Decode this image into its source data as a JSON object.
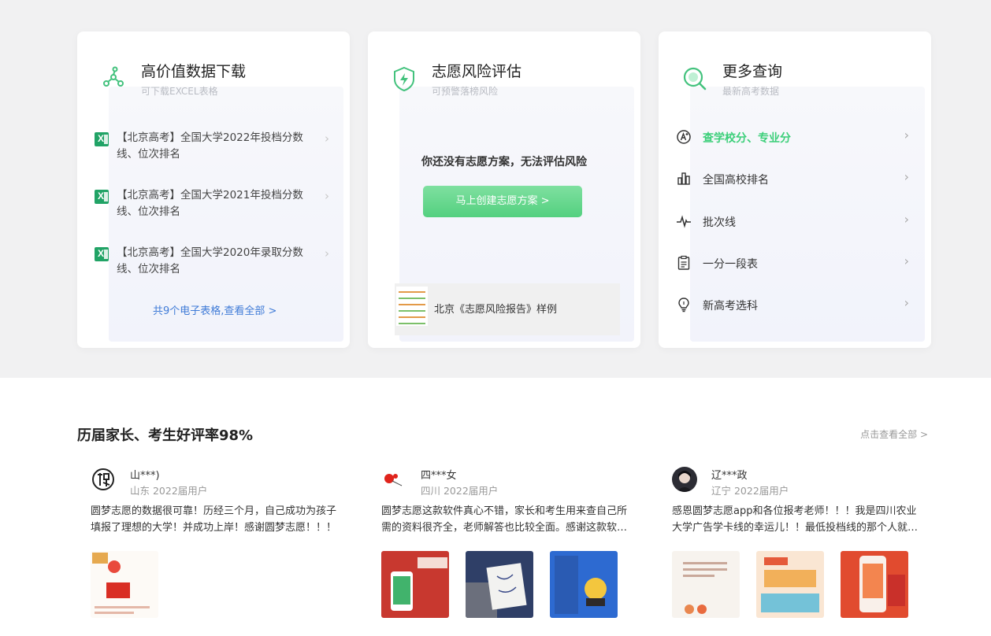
{
  "cards": {
    "download": {
      "title": "高价值数据下载",
      "subtitle": "可下载EXCEL表格",
      "items": [
        {
          "label": "【北京高考】全国大学2022年投档分数线、位次排名"
        },
        {
          "label": "【北京高考】全国大学2021年投档分数线、位次排名"
        },
        {
          "label": "【北京高考】全国大学2020年录取分数线、位次排名"
        }
      ],
      "see_all": "共9个电子表格,查看全部 >",
      "icon": "network-icon",
      "accent": "#43c27d"
    },
    "risk": {
      "title": "志愿风险评估",
      "subtitle": "可预警落榜风险",
      "message": "你还没有志愿方案，无法评估风险",
      "button": "马上创建志愿方案 >",
      "report": "北京《志愿风险报告》样例",
      "icon": "shield-bolt-icon",
      "button_color": "#53d07f"
    },
    "more": {
      "title": "更多查询",
      "subtitle": "最新高考数据",
      "icon": "search-icon",
      "items": [
        {
          "label": "查学校分、专业分",
          "icon": "score-icon",
          "active": true
        },
        {
          "label": "全国高校排名",
          "icon": "bar-chart-icon"
        },
        {
          "label": "批次线",
          "icon": "pulse-icon"
        },
        {
          "label": "一分一段表",
          "icon": "clipboard-icon"
        },
        {
          "label": "新高考选科",
          "icon": "bulb-icon"
        }
      ],
      "active_color": "#3bcf79"
    }
  },
  "reviews": {
    "title": "历届家长、考生好评率98%",
    "more": "点击查看全部 >",
    "items": [
      {
        "name": "山***)",
        "meta": "山东 2022届用户",
        "text": "圆梦志愿的数据很可靠！历经三个月，自己成功为孩子填报了理想的大学！并成功上岸！感谢圆梦志愿！！！",
        "photos": 1
      },
      {
        "name": "四***女",
        "meta": "四川 2022届用户",
        "text": "圆梦志愿这款软件真心不错，家长和考生用来查自己所需的资料很齐全，老师解答也比较全面。感谢这款软…",
        "photos": 3
      },
      {
        "name": "辽***政",
        "meta": "辽宁 2022届用户",
        "text": "感恩圆梦志愿app和各位报考老师！！！我是四川农业大学广告学卡线的幸运儿！！最低投档线的那个人就…",
        "photos": 3
      }
    ]
  }
}
